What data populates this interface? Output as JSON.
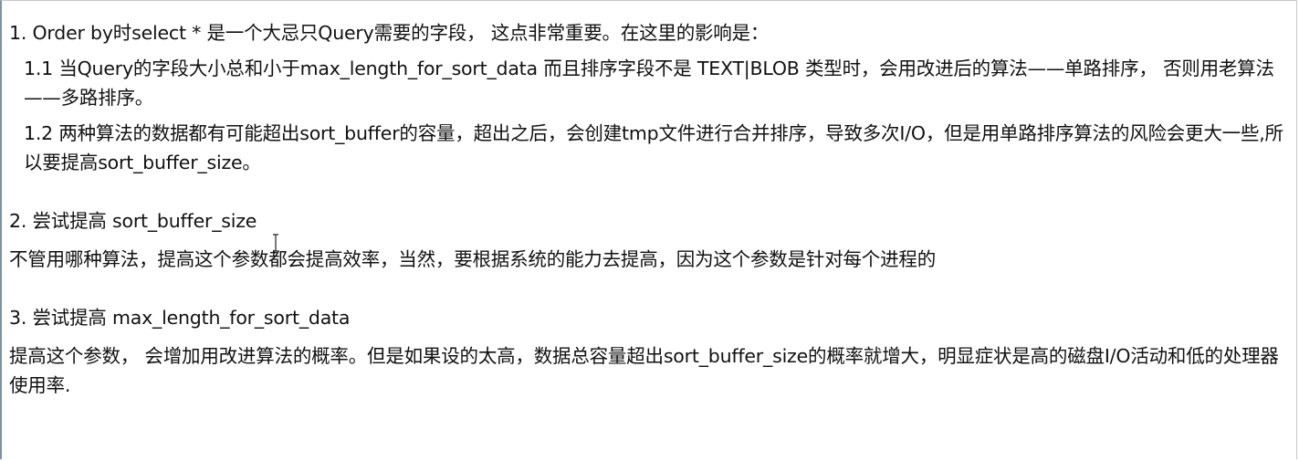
{
  "document": {
    "paragraphs": [
      "1. Order by时select * 是一个大忌只Query需要的字段， 这点非常重要。在这里的影响是：",
      "1.1 当Query的字段大小总和小于max_length_for_sort_data 而且排序字段不是 TEXT|BLOB 类型时，会用改进后的算法——单路排序， 否则用老算法——多路排序。",
      "1.2 两种算法的数据都有可能超出sort_buffer的容量，超出之后，会创建tmp文件进行合并排序，导致多次I/O，但是用单路排序算法的风险会更大一些,所以要提高sort_buffer_size。",
      "2. 尝试提高 sort_buffer_size",
      "不管用哪种算法，提高这个参数都会提高效率，当然，要根据系统的能力去提高，因为这个参数是针对每个进程的",
      "3. 尝试提高 max_length_for_sort_data",
      "提高这个参数， 会增加用改进算法的概率。但是如果设的太高，数据总容量超出sort_buffer_size的概率就增大，明显症状是高的磁盘I/O活动和低的处理器使用率."
    ]
  },
  "cursor_icon": "text-cursor-icon"
}
